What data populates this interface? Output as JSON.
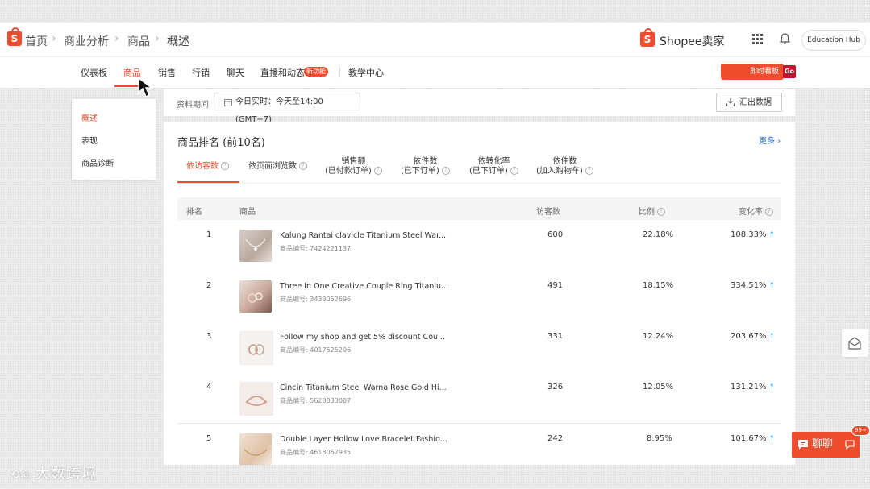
{
  "breadcrumb": {
    "home": "首页",
    "section": "商业分析",
    "category": "商品",
    "current": "概述"
  },
  "brand": "Shopee卖家",
  "education_hub": "Education Hub",
  "nav": {
    "items": [
      "仪表板",
      "商品",
      "销售",
      "行销",
      "聊天",
      "直播和动态",
      "教学中心"
    ],
    "new_badge": "新功能",
    "live_button": "即时看板",
    "go_label": "Go"
  },
  "sidemenu": [
    "概述",
    "表现",
    "商品诊断"
  ],
  "period": {
    "label": "资料期间",
    "value": "今日实时：今天至14:00 (GMT+7)"
  },
  "export_label": "汇出数据",
  "ranking": {
    "title": "商品排名 (前10名)",
    "more": "更多",
    "tabs": [
      {
        "line1": "依访客数",
        "line2": ""
      },
      {
        "line1": "依页面浏览数",
        "line2": ""
      },
      {
        "line1": "销售额",
        "line2": "(已付款订单)"
      },
      {
        "line1": "依件数",
        "line2": "(已下订单)"
      },
      {
        "line1": "依转化率",
        "line2": "(已下订单)"
      },
      {
        "line1": "依件数",
        "line2": "(加入购物车)"
      }
    ],
    "columns": {
      "rank": "排名",
      "product": "商品",
      "visitors": "访客数",
      "ratio": "比例",
      "change": "变化率"
    },
    "rows": [
      {
        "rank": "1",
        "name": "Kalung Rantai clavicle Titanium Steel War...",
        "id": "商品编号: 7424221137",
        "visitors": "600",
        "ratio": "22.18%",
        "change": "108.33%"
      },
      {
        "rank": "2",
        "name": "Three In One Creative Couple Ring Titaniu...",
        "id": "商品编号: 3433052696",
        "visitors": "491",
        "ratio": "18.15%",
        "change": "334.51%"
      },
      {
        "rank": "3",
        "name": "Follow my shop and get 5% discount Cou...",
        "id": "商品编号: 4017525206",
        "visitors": "331",
        "ratio": "12.24%",
        "change": "203.67%"
      },
      {
        "rank": "4",
        "name": "Cincin Titanium Steel Warna Rose Gold Hi...",
        "id": "商品编号: 5623833087",
        "visitors": "326",
        "ratio": "12.05%",
        "change": "131.21%"
      },
      {
        "rank": "5",
        "name": "Double Layer Hollow Love Bracelet Fashio...",
        "id": "商品编号: 4618067935",
        "visitors": "242",
        "ratio": "8.95%",
        "change": "101.67%"
      }
    ]
  },
  "chat": {
    "label": "聊聊",
    "badge": "99+"
  },
  "watermark": "大数跨境",
  "colors": {
    "accent": "#ee4d2d",
    "link": "#2673dd",
    "up_arrow": "#1a9ef0"
  }
}
